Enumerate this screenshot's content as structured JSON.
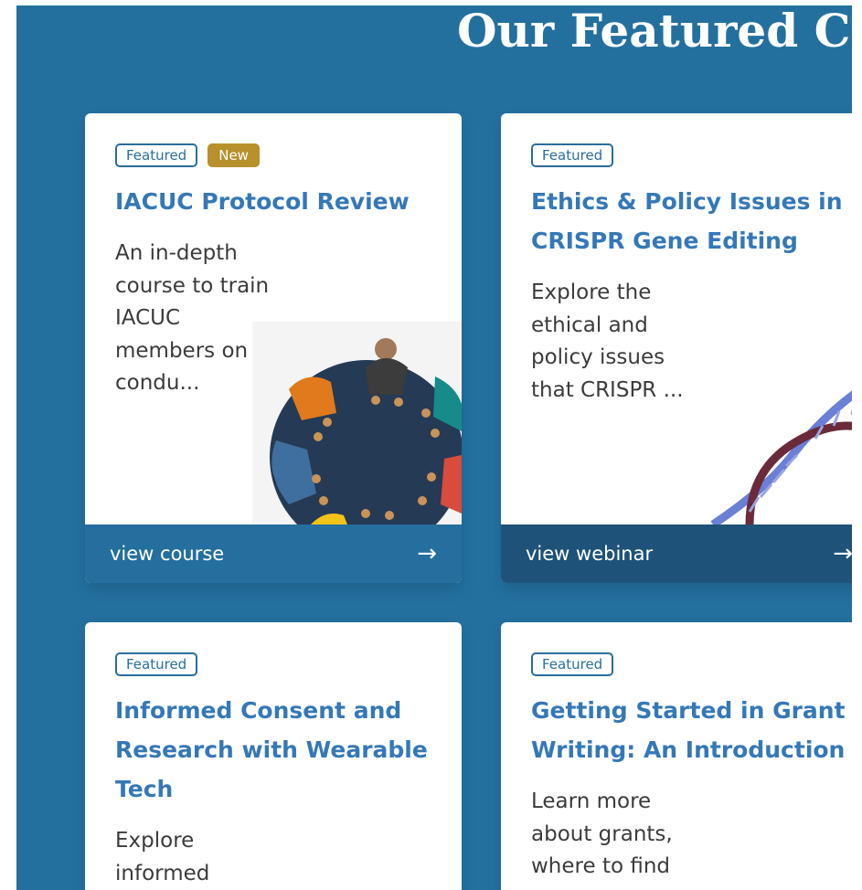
{
  "section": {
    "title": "Our Featured Cou"
  },
  "cards": [
    {
      "badges": [
        "Featured",
        "New"
      ],
      "title": "IACUC Protocol Review",
      "description": "An in-depth course to train IACUC members on condu...",
      "image_icon": "round-table-meeting-illustration",
      "link_label": "view course",
      "arrow": "→"
    },
    {
      "badges": [
        "Featured"
      ],
      "title": "Ethics & Policy Issues in CRISPR Gene Editing",
      "description": "Explore the ethical and policy issues that CRISPR ...",
      "image_icon": "dna-helix-illustration",
      "link_label": "view webinar",
      "arrow": "→"
    },
    {
      "badges": [
        "Featured"
      ],
      "title": "Informed Consent and Research with Wearable Tech",
      "description": "Explore informed"
    },
    {
      "badges": [
        "Featured"
      ],
      "title": "Getting Started in Grant Writing: An Introduction",
      "description": "Learn more about grants, where to find"
    }
  ],
  "colors": {
    "section_bg": "#23709f",
    "title_blue": "#3578b7",
    "badge_border": "#2a6d9c",
    "badge_new": "#b8912c",
    "footer_light": "#256f9f",
    "footer_dark": "#1e5279"
  }
}
